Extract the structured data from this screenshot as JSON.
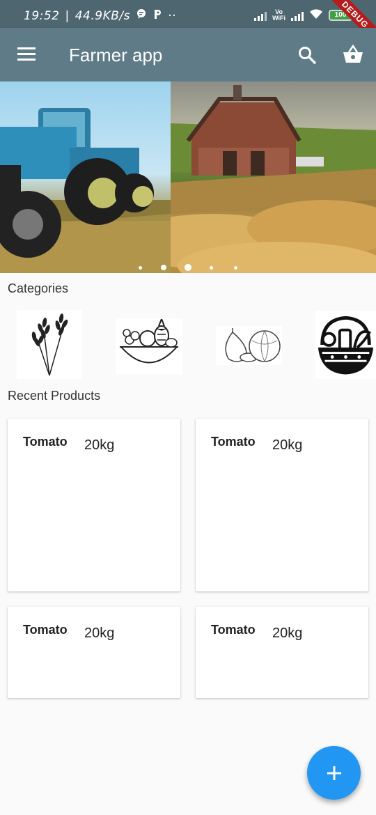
{
  "status_bar": {
    "time": "19:52",
    "speed": "44.9KB/s",
    "battery": "100",
    "vowifi_top": "Vo",
    "vowifi_bottom": "WiFi",
    "debug_banner": "DEBUG"
  },
  "app_bar": {
    "title": "Farmer app",
    "menu_icon": "menu-icon",
    "search_icon": "search-icon",
    "cart_icon": "shopping-basket-icon"
  },
  "carousel": {
    "slides": [
      "tractor-in-field",
      "red-barn-with-hay"
    ],
    "dot_count": 5,
    "active_dot": 2
  },
  "categories": {
    "label": "Categories",
    "items": [
      "wheat-icon",
      "fruit-bowl-icon",
      "vegetables-icon",
      "food-basket-icon"
    ]
  },
  "recent_products": {
    "label": "Recent Products",
    "items": [
      {
        "name": "Tomato",
        "quantity": "20kg"
      },
      {
        "name": "Tomato",
        "quantity": "20kg"
      },
      {
        "name": "Tomato",
        "quantity": "20kg"
      },
      {
        "name": "Tomato",
        "quantity": "20kg"
      }
    ]
  },
  "fab": {
    "icon": "plus-icon",
    "color": "#2196f3"
  },
  "colors": {
    "status_bar": "#4e6670",
    "app_bar": "#5e7b87",
    "background": "#fafafa"
  }
}
